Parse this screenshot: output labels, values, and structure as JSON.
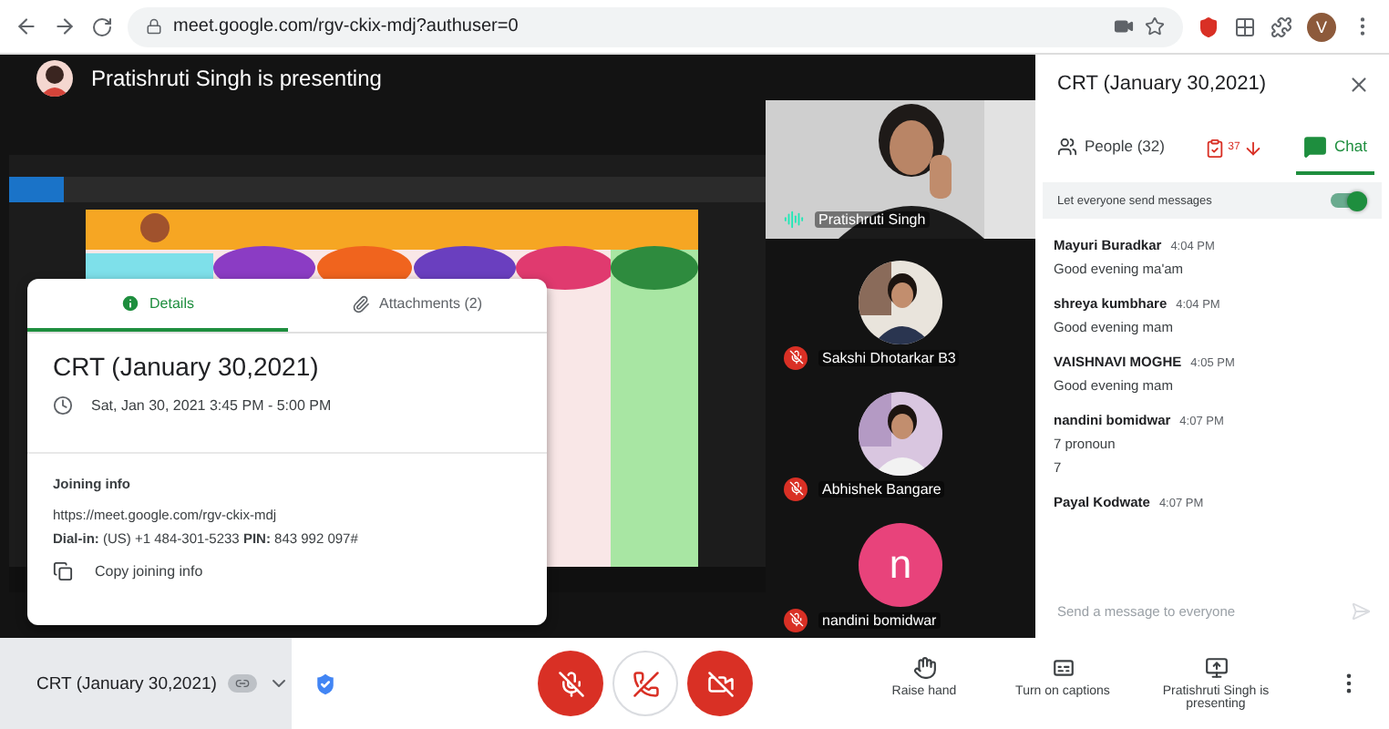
{
  "browser": {
    "url": "meet.google.com/rgv-ckix-mdj?authuser=0",
    "profile_initial": "V"
  },
  "presenter_banner": "Pratishruti Singh is presenting",
  "details_card": {
    "tabs": [
      {
        "label": "Details",
        "kind": "details",
        "selected": true
      },
      {
        "label": "Attachments (2)",
        "kind": "attachments",
        "selected": false
      }
    ],
    "title": "CRT (January 30,2021)",
    "time": "Sat, Jan 30, 2021 3:45 PM - 5:00 PM",
    "joining_heading": "Joining info",
    "link": "https://meet.google.com/rgv-ckix-mdj",
    "dial_in": "**Dial-in:** (US) +1 484-301-5233  **PIN:** 843 992 097#",
    "copy": "Copy joining info"
  },
  "participants": [
    {
      "name": "Pratishruti Singh",
      "kind": "video",
      "muted": false
    },
    {
      "name": "Sakshi Dhotarkar B3",
      "muted": true
    },
    {
      "name": "Abhishek Bangare",
      "muted": true
    },
    {
      "name": "nandini bomidwar",
      "kind": "initial",
      "initial": "n",
      "muted": true
    }
  ],
  "bottom_bar": {
    "meeting_title": "CRT (January 30,2021)",
    "mic_on": false,
    "camera_on": false,
    "actions": [
      {
        "label": "Raise hand",
        "kind": "hand"
      },
      {
        "label": "Turn on captions",
        "kind": "captions"
      },
      {
        "label": "Pratishruti Singh is presenting",
        "kind": "present"
      }
    ]
  },
  "panel": {
    "title": "CRT (January 30,2021)",
    "tabs": [
      {
        "label": "People (32)",
        "kind": "people",
        "selected": false
      },
      {
        "label": "Chat",
        "kind": "chat",
        "selected": true
      }
    ],
    "attendance_count": "37",
    "setting": {
      "label": "Let everyone send messages",
      "on": true
    },
    "messages": [
      {
        "sender": "Mayuri Buradkar",
        "time": "4:04 PM",
        "lines": [
          "Good evening ma'am"
        ]
      },
      {
        "sender": "shreya kumbhare",
        "time": "4:04 PM",
        "lines": [
          "Good evening mam"
        ]
      },
      {
        "sender": "VAISHNAVI MOGHE",
        "time": "4:05 PM",
        "lines": [
          "Good evening mam"
        ]
      },
      {
        "sender": "nandini bomidwar",
        "time": "4:07 PM",
        "lines": [
          "7 pronoun",
          "7"
        ]
      },
      {
        "sender": "Payal Kodwate",
        "time": "4:07 PM"
      }
    ],
    "input": {
      "placeholder": "Send a message to everyone"
    }
  }
}
